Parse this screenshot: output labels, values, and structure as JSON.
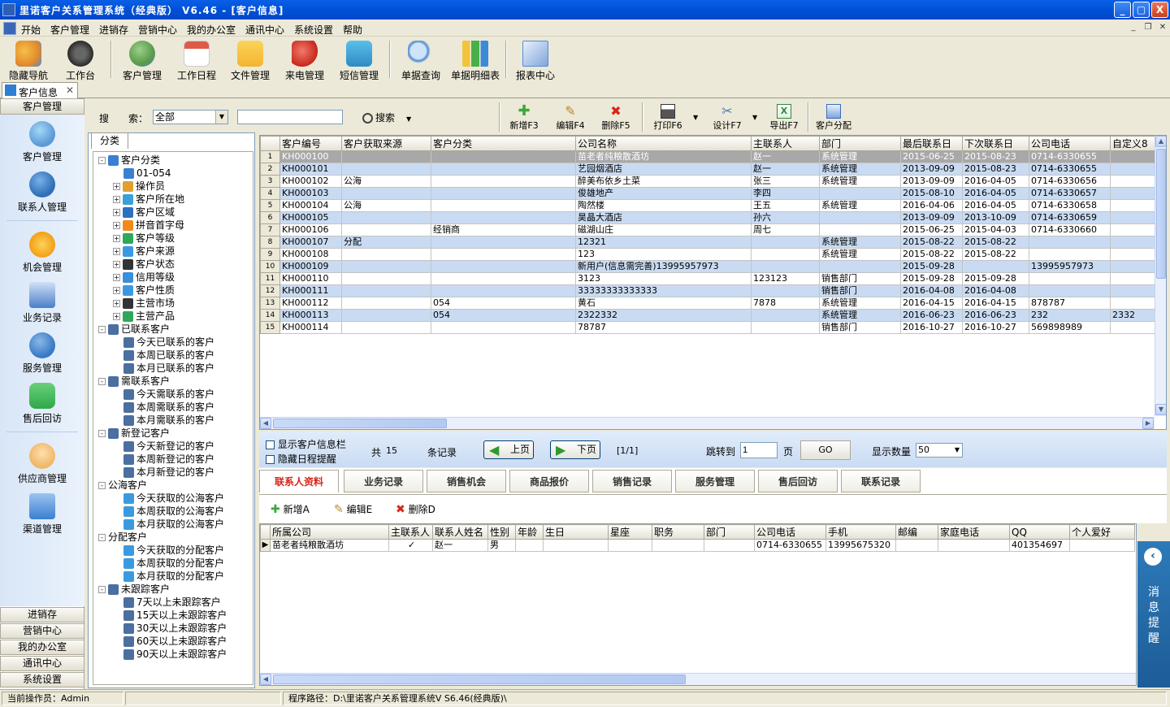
{
  "window": {
    "title": "里诺客户关系管理系统（经典版） V6.46 - [客户信息]",
    "min": "_",
    "max": "▢",
    "close": "X"
  },
  "menu": [
    "开始",
    "客户管理",
    "进销存",
    "营销中心",
    "我的办公室",
    "通讯中心",
    "系统设置",
    "帮助"
  ],
  "toolbar": [
    {
      "label": "隐藏导航",
      "icon": "butterfly-icon",
      "color": "#e58a2a"
    },
    {
      "label": "工作台",
      "icon": "clock-icon",
      "color": "#3a3a3a"
    },
    {
      "label": "客户管理",
      "icon": "customers-icon",
      "color": "#6aa05a"
    },
    {
      "label": "工作日程",
      "icon": "calendar-icon",
      "color": "#e05a4a"
    },
    {
      "label": "文件管理",
      "icon": "folder-icon",
      "color": "#f2b530"
    },
    {
      "label": "来电管理",
      "icon": "phone-icon",
      "color": "#d8261a"
    },
    {
      "label": "短信管理",
      "icon": "message-icon",
      "color": "#2ea0d4"
    },
    {
      "label": "单据查询",
      "icon": "magnifier-icon",
      "color": "#4a8ad4"
    },
    {
      "label": "单据明细表",
      "icon": "bar-chart-icon",
      "color": "#48b048"
    },
    {
      "label": "报表中心",
      "icon": "report-icon",
      "color": "#5a8ad0"
    }
  ],
  "doc_tab": {
    "label": "客户信息",
    "close": "✕"
  },
  "leftnav": {
    "header": "客户管理",
    "items": [
      {
        "label": "客户管理",
        "icon": "customers-icon",
        "color": "#5a9ad8"
      },
      {
        "label": "联系人管理",
        "icon": "contact-person-icon",
        "color": "#2e6fb6"
      },
      {
        "label": "机会管理",
        "icon": "star-icon",
        "color": "#f5a21b"
      },
      {
        "label": "业务记录",
        "icon": "chart-monitor-icon",
        "color": "#4a7fc6"
      },
      {
        "label": "服务管理",
        "icon": "globe-icon",
        "color": "#3a7ac4"
      },
      {
        "label": "售后回访",
        "icon": "chat-bubble-icon",
        "color": "#2da84a"
      },
      {
        "label": "供应商管理",
        "icon": "supplier-face-icon",
        "color": "#f0b86a"
      },
      {
        "label": "渠道管理",
        "icon": "envelope-stack-icon",
        "color": "#3b7fd0"
      }
    ],
    "bottom": [
      "进销存",
      "营销中心",
      "我的办公室",
      "通讯中心",
      "系统设置"
    ]
  },
  "search": {
    "label1": "搜",
    "label2": "索：",
    "select_value": "全部",
    "input_value": "",
    "search_button": "搜索"
  },
  "actions": [
    {
      "label": "新增F3",
      "icon": "plus-icon",
      "color": "#3aa83a"
    },
    {
      "label": "编辑F4",
      "icon": "edit-icon",
      "color": "#b88a2a"
    },
    {
      "label": "删除F5",
      "icon": "delete-icon",
      "color": "#d8261a"
    },
    {
      "label": "打印F6",
      "icon": "printer-icon",
      "color": "#555555"
    },
    {
      "label": "设计F7",
      "icon": "tools-icon",
      "color": "#4a7ab0"
    },
    {
      "label": "导出F7",
      "icon": "excel-icon",
      "color": "#2e8a3e"
    },
    {
      "label": "客户分配",
      "icon": "assign-icon",
      "color": "#3a6fc0"
    }
  ],
  "tree": {
    "tab": "分类",
    "nodes": [
      {
        "label": "客户分类",
        "level": 0,
        "exp": "-",
        "color": "#3a7fd0"
      },
      {
        "label": "01-054",
        "level": 1,
        "exp": "",
        "color": "#3a7fd0"
      },
      {
        "label": "操作员",
        "level": 1,
        "exp": "+",
        "color": "#e0a030"
      },
      {
        "label": "客户所在地",
        "level": 1,
        "exp": "+",
        "color": "#3aa0d8"
      },
      {
        "label": "客户区域",
        "level": 1,
        "exp": "+",
        "color": "#2e70c0"
      },
      {
        "label": "拼音首字母",
        "level": 1,
        "exp": "+",
        "color": "#f08a1a"
      },
      {
        "label": "客户等级",
        "level": 1,
        "exp": "+",
        "color": "#2ea85a"
      },
      {
        "label": "客户来源",
        "level": 1,
        "exp": "+",
        "color": "#3a9ae0"
      },
      {
        "label": "客户状态",
        "level": 1,
        "exp": "+",
        "color": "#333333"
      },
      {
        "label": "信用等级",
        "level": 1,
        "exp": "+",
        "color": "#3a8fd8"
      },
      {
        "label": "客户性质",
        "level": 1,
        "exp": "+",
        "color": "#3a9ae0"
      },
      {
        "label": "主营市场",
        "level": 1,
        "exp": "+",
        "color": "#333333"
      },
      {
        "label": "主营产品",
        "level": 1,
        "exp": "+",
        "color": "#2ea85a"
      },
      {
        "label": "已联系客户",
        "level": 0,
        "exp": "-",
        "color": "#4a6fa0"
      },
      {
        "label": "今天已联系的客户",
        "level": 1,
        "exp": "",
        "color": "#4a6fa0"
      },
      {
        "label": "本周已联系的客户",
        "level": 1,
        "exp": "",
        "color": "#4a6fa0"
      },
      {
        "label": "本月已联系的客户",
        "level": 1,
        "exp": "",
        "color": "#4a6fa0"
      },
      {
        "label": "需联系客户",
        "level": 0,
        "exp": "-",
        "color": "#4a6fa0"
      },
      {
        "label": "今天需联系的客户",
        "level": 1,
        "exp": "",
        "color": "#4a6fa0"
      },
      {
        "label": "本周需联系的客户",
        "level": 1,
        "exp": "",
        "color": "#4a6fa0"
      },
      {
        "label": "本月需联系的客户",
        "level": 1,
        "exp": "",
        "color": "#4a6fa0"
      },
      {
        "label": "新登记客户",
        "level": 0,
        "exp": "-",
        "color": "#4a6fa0"
      },
      {
        "label": "今天新登记的客户",
        "level": 1,
        "exp": "",
        "color": "#4a6fa0"
      },
      {
        "label": "本周新登记的客户",
        "level": 1,
        "exp": "",
        "color": "#4a6fa0"
      },
      {
        "label": "本月新登记的客户",
        "level": 1,
        "exp": "",
        "color": "#4a6fa0"
      },
      {
        "label": "公海客户",
        "level": 0,
        "exp": "-",
        "color": ""
      },
      {
        "label": "今天获取的公海客户",
        "level": 1,
        "exp": "",
        "color": "#3a9ae0"
      },
      {
        "label": "本周获取的公海客户",
        "level": 1,
        "exp": "",
        "color": "#3a9ae0"
      },
      {
        "label": "本月获取的公海客户",
        "level": 1,
        "exp": "",
        "color": "#3a9ae0"
      },
      {
        "label": "分配客户",
        "level": 0,
        "exp": "-",
        "color": ""
      },
      {
        "label": "今天获取的分配客户",
        "level": 1,
        "exp": "",
        "color": "#3a9ae0"
      },
      {
        "label": "本周获取的分配客户",
        "level": 1,
        "exp": "",
        "color": "#3a9ae0"
      },
      {
        "label": "本月获取的分配客户",
        "level": 1,
        "exp": "",
        "color": "#3a9ae0"
      },
      {
        "label": "未跟踪客户",
        "level": 0,
        "exp": "-",
        "color": "#4a6fa0"
      },
      {
        "label": "7天以上未跟踪客户",
        "level": 1,
        "exp": "",
        "color": "#4a6fa0"
      },
      {
        "label": "15天以上未跟踪客户",
        "level": 1,
        "exp": "",
        "color": "#4a6fa0"
      },
      {
        "label": "30天以上未跟踪客户",
        "level": 1,
        "exp": "",
        "color": "#4a6fa0"
      },
      {
        "label": "60天以上未跟踪客户",
        "level": 1,
        "exp": "",
        "color": "#4a6fa0"
      },
      {
        "label": "90天以上未跟踪客户",
        "level": 1,
        "exp": "",
        "color": "#4a6fa0"
      }
    ]
  },
  "grid": {
    "columns": [
      "客户编号",
      "客户获取来源",
      "客户分类",
      "公司名称",
      "主联系人",
      "部门",
      "最后联系日",
      "下次联系日",
      "公司电话",
      "自定义8"
    ],
    "rows": [
      [
        "1",
        "KH000100",
        "",
        "",
        "苗老者纯粮散酒坊",
        "赵一",
        "系统管理",
        "2015-06-25",
        "2015-08-23",
        "0714-6330655",
        ""
      ],
      [
        "2",
        "KH000101",
        "",
        "",
        "艺园烟酒店",
        "赵一",
        "系统管理",
        "2013-09-09",
        "2015-08-23",
        "0714-6330655",
        ""
      ],
      [
        "3",
        "KH000102",
        "公海",
        "",
        "醉美布依乡土菜",
        "张三",
        "系统管理",
        "2013-09-09",
        "2016-04-05",
        "0714-6330656",
        ""
      ],
      [
        "4",
        "KH000103",
        "",
        "",
        "俊雄地产",
        "李四",
        "",
        "2015-08-10",
        "2016-04-05",
        "0714-6330657",
        ""
      ],
      [
        "5",
        "KH000104",
        "公海",
        "",
        "陶然楼",
        "王五",
        "系统管理",
        "2016-04-06",
        "2016-04-05",
        "0714-6330658",
        ""
      ],
      [
        "6",
        "KH000105",
        "",
        "",
        "昊晶大酒店",
        "孙六",
        "",
        "2013-09-09",
        "2013-10-09",
        "0714-6330659",
        ""
      ],
      [
        "7",
        "KH000106",
        "",
        "经销商",
        "磁湖山庄",
        "周七",
        "",
        "2015-06-25",
        "2015-04-03",
        "0714-6330660",
        ""
      ],
      [
        "8",
        "KH000107",
        "分配",
        "",
        "12321",
        "",
        "系统管理",
        "2015-08-22",
        "2015-08-22",
        "",
        ""
      ],
      [
        "9",
        "KH000108",
        "",
        "",
        "123",
        "",
        "系统管理",
        "2015-08-22",
        "2015-08-22",
        "",
        ""
      ],
      [
        "10",
        "KH000109",
        "",
        "",
        "新用户(信息需完善)13995957973",
        "",
        "",
        "2015-09-28",
        "",
        "13995957973",
        ""
      ],
      [
        "11",
        "KH000110",
        "",
        "",
        "3123",
        "123123",
        "销售部门",
        "2015-09-28",
        "2015-09-28",
        "",
        ""
      ],
      [
        "12",
        "KH000111",
        "",
        "",
        "33333333333333",
        "",
        "销售部门",
        "2016-04-08",
        "2016-04-08",
        "",
        ""
      ],
      [
        "13",
        "KH000112",
        "",
        "054",
        "黄石",
        "7878",
        "系统管理",
        "2016-04-15",
        "2016-04-15",
        "878787",
        ""
      ],
      [
        "14",
        "KH000113",
        "",
        "054",
        "2322332",
        "",
        "系统管理",
        "2016-06-23",
        "2016-06-23",
        "232",
        "2332"
      ],
      [
        "15",
        "KH000114",
        "",
        "",
        "78787",
        "",
        "销售部门",
        "2016-10-27",
        "2016-10-27",
        "569898989",
        ""
      ]
    ]
  },
  "pager": {
    "show_info": "显示客户信息栏",
    "hide_schedule": "隐藏日程提醒",
    "total_prefix": "共",
    "total": "15",
    "total_suffix": "条记录",
    "prev": "上页",
    "next": "下页",
    "page_info": "[1/1]",
    "jump_label": "跳转到",
    "jump_value": "1",
    "page_unit": "页",
    "go": "GO",
    "count_label": "显示数量",
    "count_value": "50"
  },
  "bottom_tabs": [
    "联系人资料",
    "业务记录",
    "销售机会",
    "商品报价",
    "销售记录",
    "服务管理",
    "售后回访",
    "联系记录"
  ],
  "bottom_actions": [
    {
      "label": "新增A",
      "icon": "plus-icon",
      "color": "#3aa83a"
    },
    {
      "label": "编辑E",
      "icon": "edit-icon",
      "color": "#b88a2a"
    },
    {
      "label": "删除D",
      "icon": "delete-icon",
      "color": "#d8261a"
    }
  ],
  "contacts": {
    "columns": [
      "所属公司",
      "主联系人",
      "联系人姓名",
      "性别",
      "年龄",
      "生日",
      "星座",
      "职务",
      "部门",
      "公司电话",
      "手机",
      "邮编",
      "家庭电话",
      "QQ",
      "个人爱好"
    ],
    "rows": [
      [
        "苗老者纯粮散酒坊",
        "✓",
        "赵一",
        "男",
        "",
        "",
        "",
        "",
        "",
        "0714-6330655",
        "13995675320",
        "",
        "",
        "401354697",
        ""
      ]
    ]
  },
  "message_panel": {
    "label": "消息提醒",
    "arrow": "‹"
  },
  "status": {
    "operator_label": "当前操作员：",
    "operator": "Admin",
    "path": "程序路径：D:\\里诺客户关系管理系统V S6.46(经典版)\\"
  }
}
